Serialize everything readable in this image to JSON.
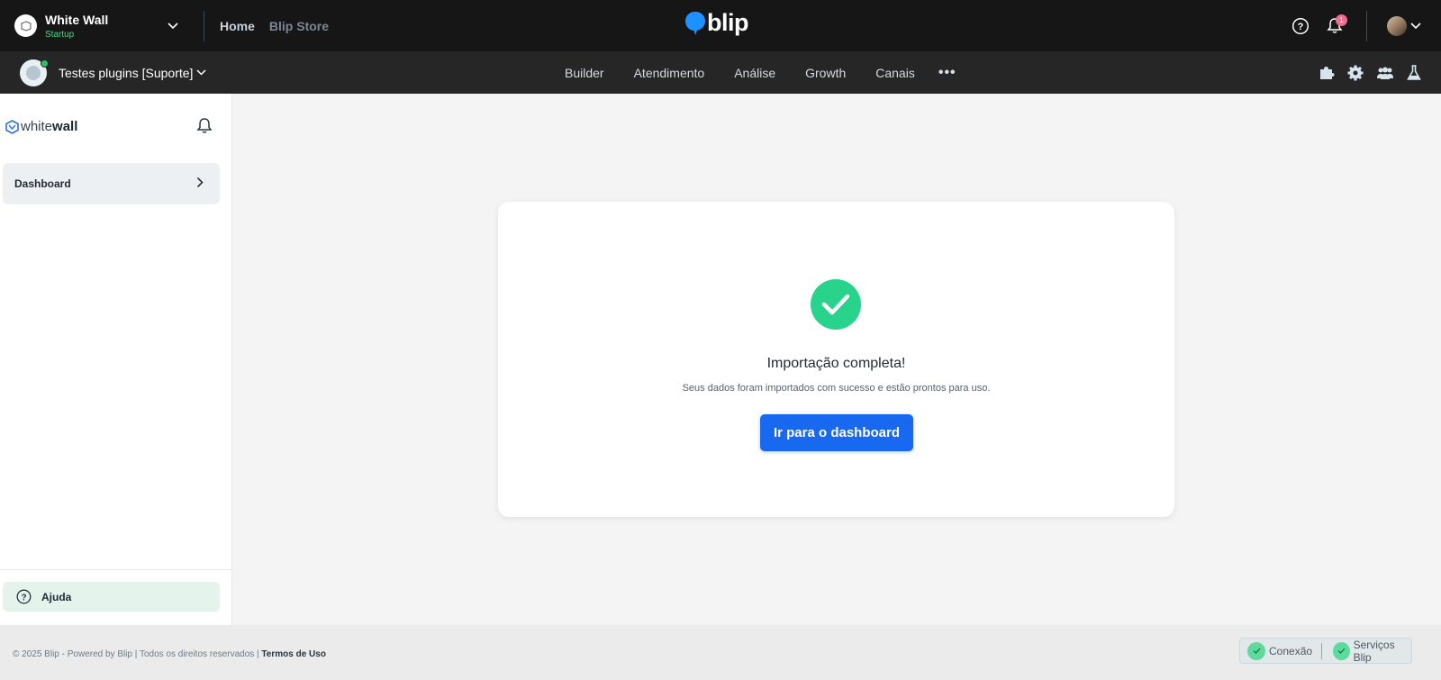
{
  "topbar": {
    "org_name": "White Wall",
    "org_plan": "Startup",
    "nav": {
      "home": "Home",
      "store": "Blip Store"
    },
    "brand": "blip",
    "notification_count": "1"
  },
  "subbar": {
    "bot_name": "Testes plugins [Suporte]",
    "tabs": [
      "Builder",
      "Atendimento",
      "Análise",
      "Growth",
      "Canais"
    ],
    "more": "•••"
  },
  "sidebar": {
    "logo_light": "white",
    "logo_bold": "wall",
    "items": [
      {
        "label": "Dashboard"
      }
    ],
    "help_label": "Ajuda"
  },
  "main": {
    "title": "Importação completa!",
    "subtitle": "Seus dados foram importados com sucesso e estão prontos para uso.",
    "button_label": "Ir para o dashboard"
  },
  "footer": {
    "copyright": "© 2025 Blip - Powered by Blip | Todos os direitos reservados |",
    "terms": "Termos de Uso",
    "status": [
      "Conexão",
      "Serviços Blip"
    ]
  },
  "colors": {
    "topbar_bg": "#161616",
    "subbar_bg": "#262626",
    "accent_blue": "#1968f0",
    "success_green": "#28d48c",
    "plan_green": "#3ddc84"
  }
}
